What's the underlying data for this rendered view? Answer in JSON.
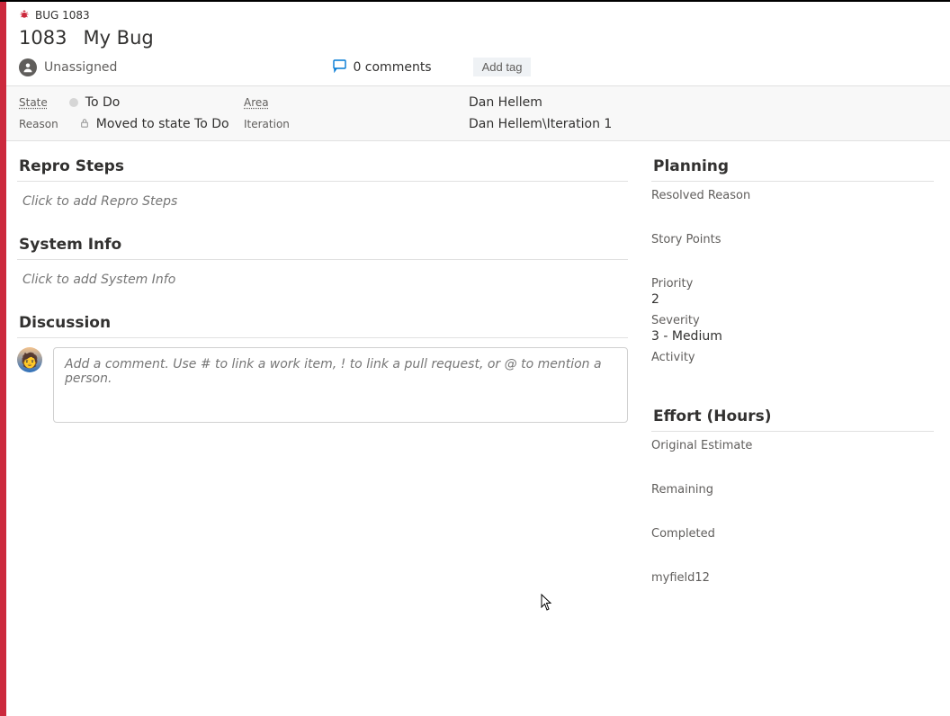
{
  "header": {
    "bug_label": "BUG 1083",
    "id": "1083",
    "title": "My Bug"
  },
  "meta": {
    "assignee": "Unassigned",
    "comments_label": "0 comments",
    "add_tag_label": "Add tag"
  },
  "classification": {
    "state_label": "State",
    "state_value": "To Do",
    "reason_label": "Reason",
    "reason_value": "Moved to state To Do",
    "area_label": "Area",
    "area_value": "Dan Hellem",
    "iteration_label": "Iteration",
    "iteration_value": "Dan Hellem\\Iteration 1"
  },
  "main": {
    "repro_title": "Repro Steps",
    "repro_placeholder": "Click to add Repro Steps",
    "sysinfo_title": "System Info",
    "sysinfo_placeholder": "Click to add System Info",
    "discussion_title": "Discussion",
    "comment_placeholder": "Add a comment. Use # to link a work item, ! to link a pull request, or @ to mention a person."
  },
  "side": {
    "planning_title": "Planning",
    "resolved_reason_label": "Resolved Reason",
    "story_points_label": "Story Points",
    "priority_label": "Priority",
    "priority_value": "2",
    "severity_label": "Severity",
    "severity_value": "3 - Medium",
    "activity_label": "Activity",
    "effort_title": "Effort (Hours)",
    "orig_est_label": "Original Estimate",
    "remaining_label": "Remaining",
    "completed_label": "Completed",
    "custom_field_label": "myfield12"
  }
}
